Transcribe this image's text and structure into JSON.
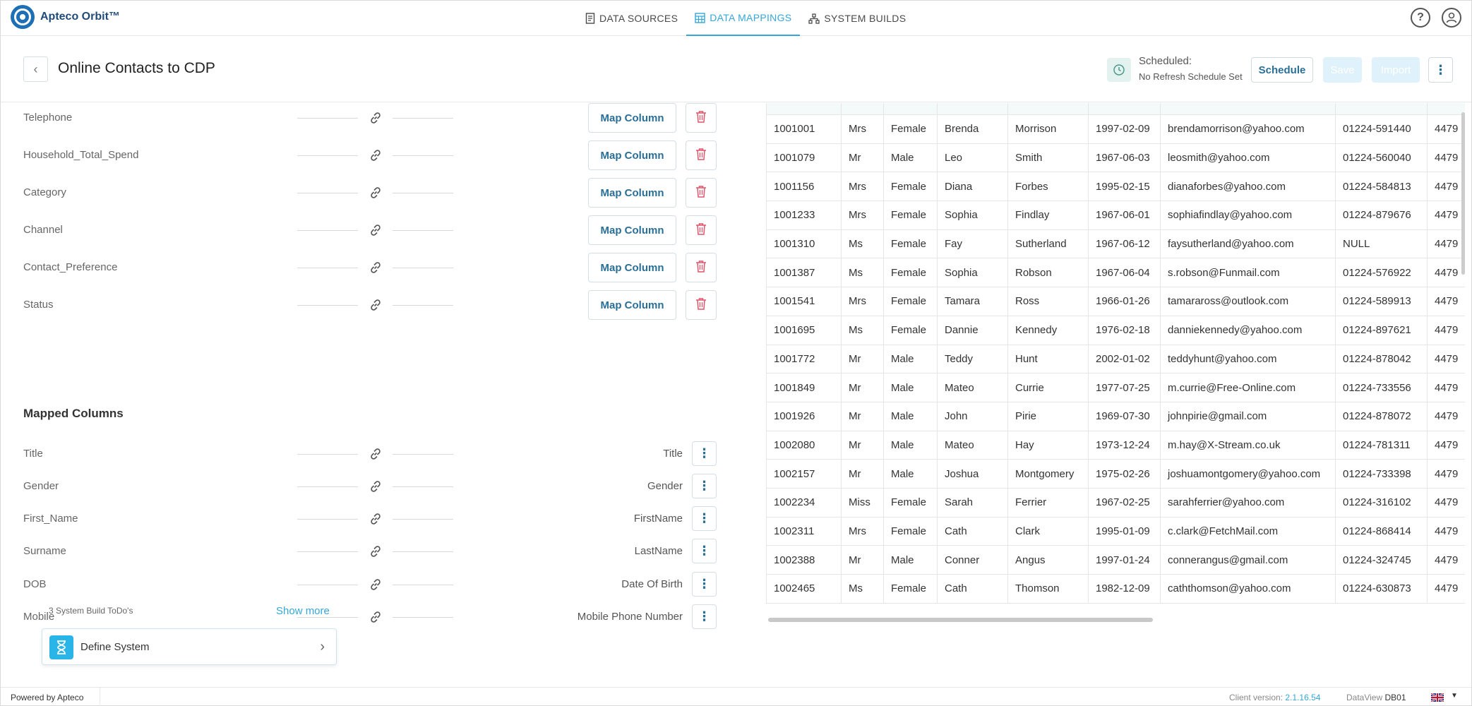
{
  "app": {
    "name": "Apteco Orbit™"
  },
  "nav": [
    {
      "label": "DATA SOURCES",
      "icon": "document-icon",
      "active": false
    },
    {
      "label": "DATA MAPPINGS",
      "icon": "table-icon",
      "active": true
    },
    {
      "label": "SYSTEM BUILDS",
      "icon": "hierarchy-icon",
      "active": false
    }
  ],
  "header": {
    "title": "Online Contacts to CDP",
    "schedule_label": "Scheduled:",
    "schedule_value": "No Refresh Schedule Set",
    "schedule_button": "Schedule",
    "save_button": "Save",
    "import_button": "Import"
  },
  "unmapped": [
    {
      "label": "Telephone",
      "action": "Map Column"
    },
    {
      "label": "Household_Total_Spend",
      "action": "Map Column"
    },
    {
      "label": "Category",
      "action": "Map Column"
    },
    {
      "label": "Channel",
      "action": "Map Column"
    },
    {
      "label": "Contact_Preference",
      "action": "Map Column"
    },
    {
      "label": "Status",
      "action": "Map Column"
    }
  ],
  "mapped_heading": "Mapped Columns",
  "mapped": [
    {
      "label": "Title",
      "target": "Title"
    },
    {
      "label": "Gender",
      "target": "Gender"
    },
    {
      "label": "First_Name",
      "target": "FirstName"
    },
    {
      "label": "Surname",
      "target": "LastName"
    },
    {
      "label": "DOB",
      "target": "Date Of Birth"
    },
    {
      "label": "Mobile",
      "target": "Mobile Phone Number"
    }
  ],
  "todo": {
    "count_text": "3 System Build ToDo's",
    "show_more": "Show more",
    "item": "Define System"
  },
  "grid": {
    "rows": [
      [
        "1001001",
        "Mrs",
        "Female",
        "Brenda",
        "Morrison",
        "1997-02-09",
        "brendamorrison@yahoo.com",
        "01224-591440",
        "4479"
      ],
      [
        "1001079",
        "Mr",
        "Male",
        "Leo",
        "Smith",
        "1967-06-03",
        "leosmith@yahoo.com",
        "01224-560040",
        "4479"
      ],
      [
        "1001156",
        "Mrs",
        "Female",
        "Diana",
        "Forbes",
        "1995-02-15",
        "dianaforbes@yahoo.com",
        "01224-584813",
        "4479"
      ],
      [
        "1001233",
        "Mrs",
        "Female",
        "Sophia",
        "Findlay",
        "1967-06-01",
        "sophiafindlay@yahoo.com",
        "01224-879676",
        "4479"
      ],
      [
        "1001310",
        "Ms",
        "Female",
        "Fay",
        "Sutherland",
        "1967-06-12",
        "faysutherland@yahoo.com",
        "NULL",
        "4479"
      ],
      [
        "1001387",
        "Ms",
        "Female",
        "Sophia",
        "Robson",
        "1967-06-04",
        "s.robson@Funmail.com",
        "01224-576922",
        "4479"
      ],
      [
        "1001541",
        "Mrs",
        "Female",
        "Tamara",
        "Ross",
        "1966-01-26",
        "tamaraross@outlook.com",
        "01224-589913",
        "4479"
      ],
      [
        "1001695",
        "Ms",
        "Female",
        "Dannie",
        "Kennedy",
        "1976-02-18",
        "danniekennedy@yahoo.com",
        "01224-897621",
        "4479"
      ],
      [
        "1001772",
        "Mr",
        "Male",
        "Teddy",
        "Hunt",
        "2002-01-02",
        "teddyhunt@yahoo.com",
        "01224-878042",
        "4479"
      ],
      [
        "1001849",
        "Mr",
        "Male",
        "Mateo",
        "Currie",
        "1977-07-25",
        "m.currie@Free-Online.com",
        "01224-733556",
        "4479"
      ],
      [
        "1001926",
        "Mr",
        "Male",
        "John",
        "Pirie",
        "1969-07-30",
        "johnpirie@gmail.com",
        "01224-878072",
        "4479"
      ],
      [
        "1002080",
        "Mr",
        "Male",
        "Mateo",
        "Hay",
        "1973-12-24",
        "m.hay@X-Stream.co.uk",
        "01224-781311",
        "4479"
      ],
      [
        "1002157",
        "Mr",
        "Male",
        "Joshua",
        "Montgomery",
        "1975-02-26",
        "joshuamontgomery@yahoo.com",
        "01224-733398",
        "4479"
      ],
      [
        "1002234",
        "Miss",
        "Female",
        "Sarah",
        "Ferrier",
        "1967-02-25",
        "sarahferrier@yahoo.com",
        "01224-316102",
        "4479"
      ],
      [
        "1002311",
        "Mrs",
        "Female",
        "Cath",
        "Clark",
        "1995-01-09",
        "c.clark@FetchMail.com",
        "01224-868414",
        "4479"
      ],
      [
        "1002388",
        "Mr",
        "Male",
        "Conner",
        "Angus",
        "1997-01-24",
        "connerangus@gmail.com",
        "01224-324745",
        "4479"
      ],
      [
        "1002465",
        "Ms",
        "Female",
        "Cath",
        "Thomson",
        "1982-12-09",
        "caththomson@yahoo.com",
        "01224-630873",
        "4479"
      ]
    ]
  },
  "footer": {
    "powered": "Powered by Apteco",
    "client_label": "Client version:",
    "client_version": "2.1.16.54",
    "dataview_label": "DataView",
    "dataview_value": "DB01"
  },
  "colors": {
    "accent": "#35a7d8",
    "brand": "#1f6fb5",
    "delete": "#e0556a"
  }
}
